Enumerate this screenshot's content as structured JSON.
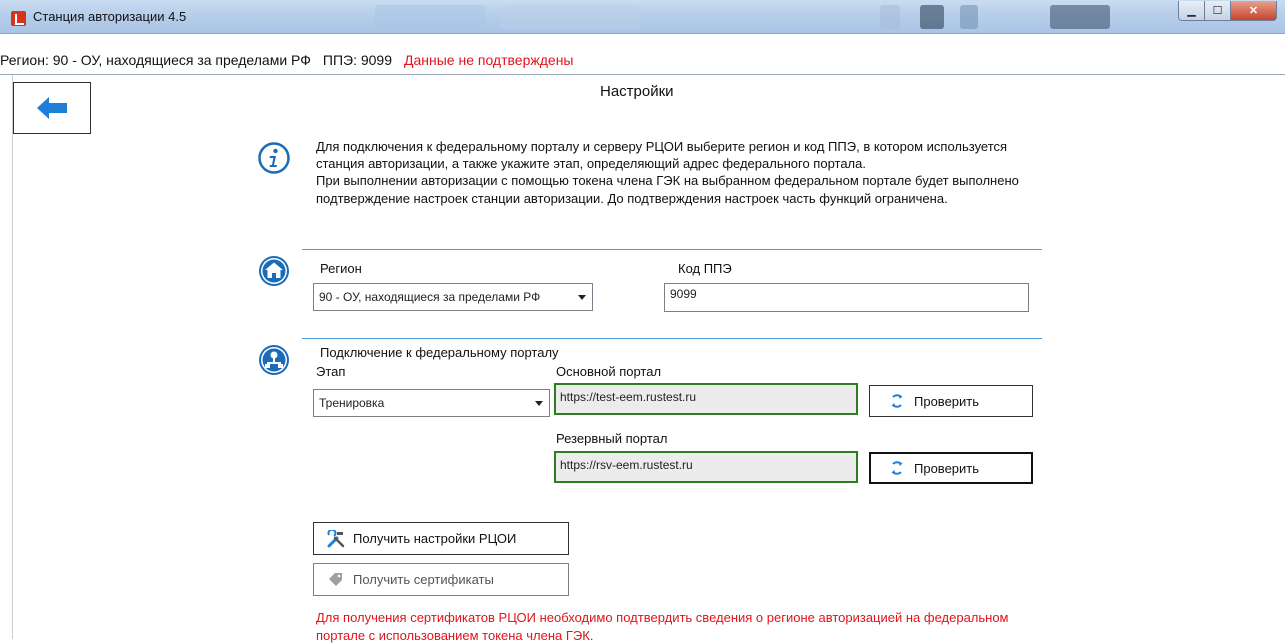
{
  "window": {
    "title": "Станция авторизации 4.5",
    "minimize_glyph": "▁",
    "maximize_glyph": "☐",
    "close_glyph": "✕"
  },
  "status": {
    "region": "Регион: 90 - ОУ, находящиеся за пределами РФ",
    "ppe": "ППЭ: 9099",
    "warning": "Данные не подтверждены",
    "warning_color": "#e1141b"
  },
  "page": {
    "title": "Настройки",
    "back_icon": "arrow-left-icon"
  },
  "info": {
    "icon": "info-icon",
    "paragraph1": "Для подключения к федеральному порталу и серверу РЦОИ выберите регион и код ППЭ, в котором используется станция авторизации, а также укажите этап, определяющий адрес федерального портала.",
    "paragraph2": "При выполнении авторизации с помощью токена члена ГЭК на выбранном федеральном портале будет выполнено подтверждение настроек станции авторизации. До подтверждения настроек часть функций ограничена."
  },
  "region_section": {
    "icon": "home-icon",
    "region_label": "Регион",
    "region_value": "90 - ОУ, находящиеся за пределами РФ",
    "ppe_label": "Код ППЭ",
    "ppe_value": "9099"
  },
  "portal_section": {
    "icon": "network-icon",
    "heading": "Подключение к федеральному порталу",
    "stage_label": "Этап",
    "stage_value": "Тренировка",
    "main_label": "Основной портал",
    "main_value": "https://test-eem.rustest.ru",
    "main_check": "Проверить",
    "reserve_label": "Резервный портал",
    "reserve_value": "https://rsv-eem.rustest.ru",
    "reserve_check": "Проверить",
    "accent_color": "#2e7d23"
  },
  "actions": {
    "get_settings": "Получить настройки РЦОИ",
    "get_certs": "Получить сертификаты",
    "warning": "Для получения сертификатов РЦОИ необходимо подтвердить сведения о регионе авторизацией на федеральном портале с использованием токена члена ГЭК."
  }
}
